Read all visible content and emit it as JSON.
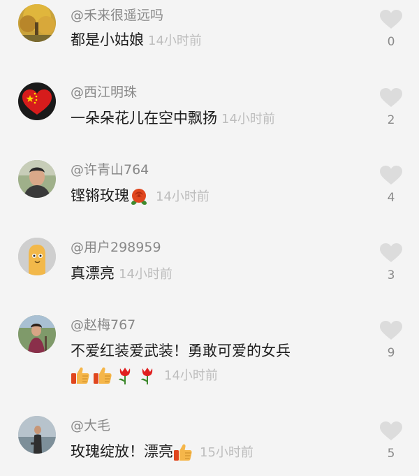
{
  "comments": [
    {
      "username": "@禾来很遥远吗",
      "text": "都是小姑娘",
      "time": "14小时前",
      "likes": "0",
      "avatar": "avatar-autumn-tree"
    },
    {
      "username": "@西江明珠",
      "text": "一朵朵花儿在空中飘扬",
      "time": "14小时前",
      "likes": "2",
      "avatar": "avatar-red-heart-flag"
    },
    {
      "username": "@许青山764",
      "text": "铿锵玫瑰",
      "time": "14小时前",
      "likes": "4",
      "avatar": "avatar-man-portrait",
      "emoji": [
        "rose-icon"
      ]
    },
    {
      "username": "@用户298959",
      "text": "真漂亮",
      "time": "14小时前",
      "likes": "3",
      "avatar": "avatar-default-cartoon"
    },
    {
      "username": "@赵梅767",
      "text": "不爱红装爱武装！勇敢可爱的女兵",
      "time": "14小时前",
      "likes": "9",
      "avatar": "avatar-woman-outdoor",
      "emoji": [
        "thumbs-up-icon",
        "thumbs-up-icon",
        "tulip-icon",
        "tulip-icon"
      ]
    },
    {
      "username": "@大毛",
      "text": "玫瑰绽放！漂亮",
      "time": "15小时前",
      "likes": "5",
      "avatar": "avatar-man-lake",
      "emoji": [
        "thumbs-up-icon"
      ]
    }
  ],
  "colors": {
    "background": "#f4f4f4",
    "username": "#888888",
    "text": "#1c1c1c",
    "time": "#bdbdbd",
    "heart": "#dcdcdc"
  }
}
